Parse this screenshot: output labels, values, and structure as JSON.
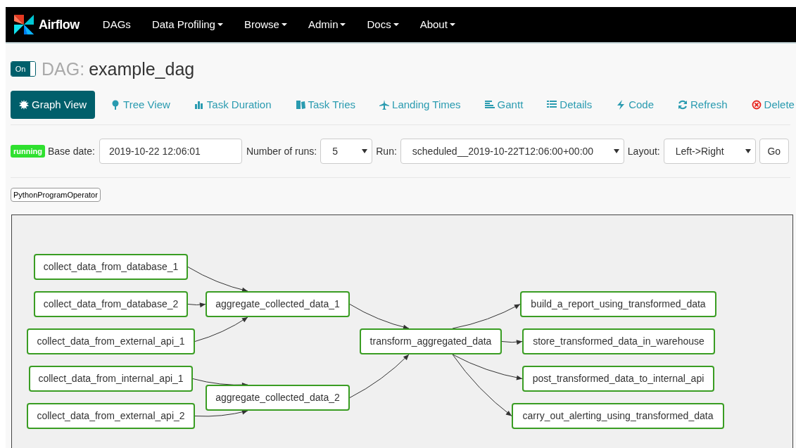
{
  "navbar": {
    "brand": "Airflow",
    "menu": [
      {
        "label": "DAGs",
        "dropdown": false
      },
      {
        "label": "Data Profiling",
        "dropdown": true
      },
      {
        "label": "Browse",
        "dropdown": true
      },
      {
        "label": "Admin",
        "dropdown": true
      },
      {
        "label": "Docs",
        "dropdown": true
      },
      {
        "label": "About",
        "dropdown": true
      }
    ]
  },
  "dag": {
    "toggle": {
      "label": "On",
      "on": true
    },
    "prefix": "DAG:",
    "name": "example_dag"
  },
  "tabs": [
    {
      "label": "Graph View",
      "selected": true
    },
    {
      "label": "Tree View",
      "selected": false
    },
    {
      "label": "Task Duration",
      "selected": false
    },
    {
      "label": "Task Tries",
      "selected": false
    },
    {
      "label": "Landing Times",
      "selected": false
    },
    {
      "label": "Gantt",
      "selected": false
    },
    {
      "label": "Details",
      "selected": false
    },
    {
      "label": "Code",
      "selected": false
    },
    {
      "label": "Refresh",
      "selected": false
    },
    {
      "label": "Delete",
      "selected": false
    }
  ],
  "controls": {
    "status": "running",
    "base_date_label": "Base date:",
    "base_date": "2019-10-22 12:06:01",
    "runs_label": "Number of runs:",
    "runs": "5",
    "run_label": "Run:",
    "run": "scheduled__2019-10-22T12:06:00+00:00",
    "layout_label": "Layout:",
    "layout": "Left->Right",
    "go": "Go"
  },
  "legend": [
    "PythonProgramOperator"
  ],
  "graph": {
    "nodes": [
      {
        "label": "collect_data_from_database_1",
        "succeeded": true
      },
      {
        "label": "collect_data_from_database_2",
        "succeeded": true
      },
      {
        "label": "collect_data_from_external_api_1",
        "succeeded": true
      },
      {
        "label": "collect_data_from_internal_api_1",
        "succeeded": true
      },
      {
        "label": "collect_data_from_external_api_2",
        "succeeded": true
      },
      {
        "label": "aggregate_collected_data_1",
        "succeeded": true
      },
      {
        "label": "aggregate_collected_data_2",
        "succeeded": true
      },
      {
        "label": "transform_aggregated_data",
        "succeeded": true
      },
      {
        "label": "build_a_report_using_transformed_data",
        "succeeded": true
      },
      {
        "label": "store_transformed_data_in_warehouse",
        "succeeded": true
      },
      {
        "label": "post_transformed_data_to_internal_api",
        "succeeded": true
      },
      {
        "label": "carry_out_alerting_using_transformed_data",
        "succeeded": true
      }
    ]
  }
}
